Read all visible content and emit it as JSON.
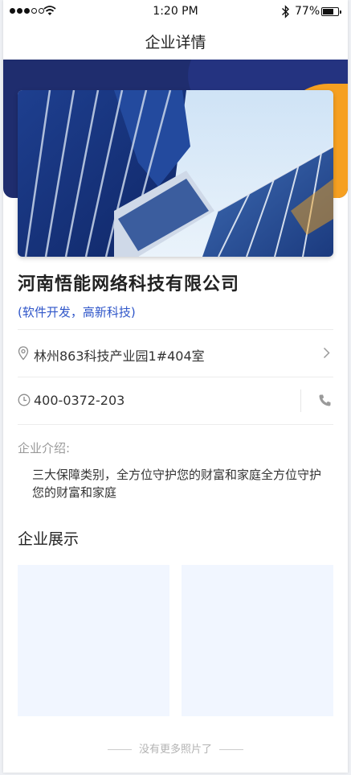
{
  "status_bar": {
    "time": "1:20 PM",
    "battery_percent": "77%",
    "battery_level": 0.77,
    "signal_bars_filled": 3,
    "signal_bars_total": 5
  },
  "nav": {
    "title": "企业详情"
  },
  "company": {
    "name": "河南悟能网络科技有限公司",
    "tags": "(软件开发，高新科技)",
    "address": "林州863科技产业园1#404室",
    "phone": "400-0372-203",
    "intro_label": "企业介绍:",
    "intro_text": "三大保障类别，全方位守护您的财富和家庭全方位守护您的财富和家庭"
  },
  "gallery": {
    "title": "企业展示",
    "item_count": 2
  },
  "footer": {
    "note": "没有更多照片了"
  },
  "colors": {
    "hero_navy": "#1f2d6e",
    "hero_accent_orange": "#f6a021",
    "tag_blue": "#2f56c9",
    "gallery_placeholder": "#f1f6ff"
  },
  "icons": {
    "address": "location-pin-icon",
    "address_action": "chevron-right-icon",
    "phone_hours": "clock-icon",
    "phone_action": "phone-icon"
  }
}
